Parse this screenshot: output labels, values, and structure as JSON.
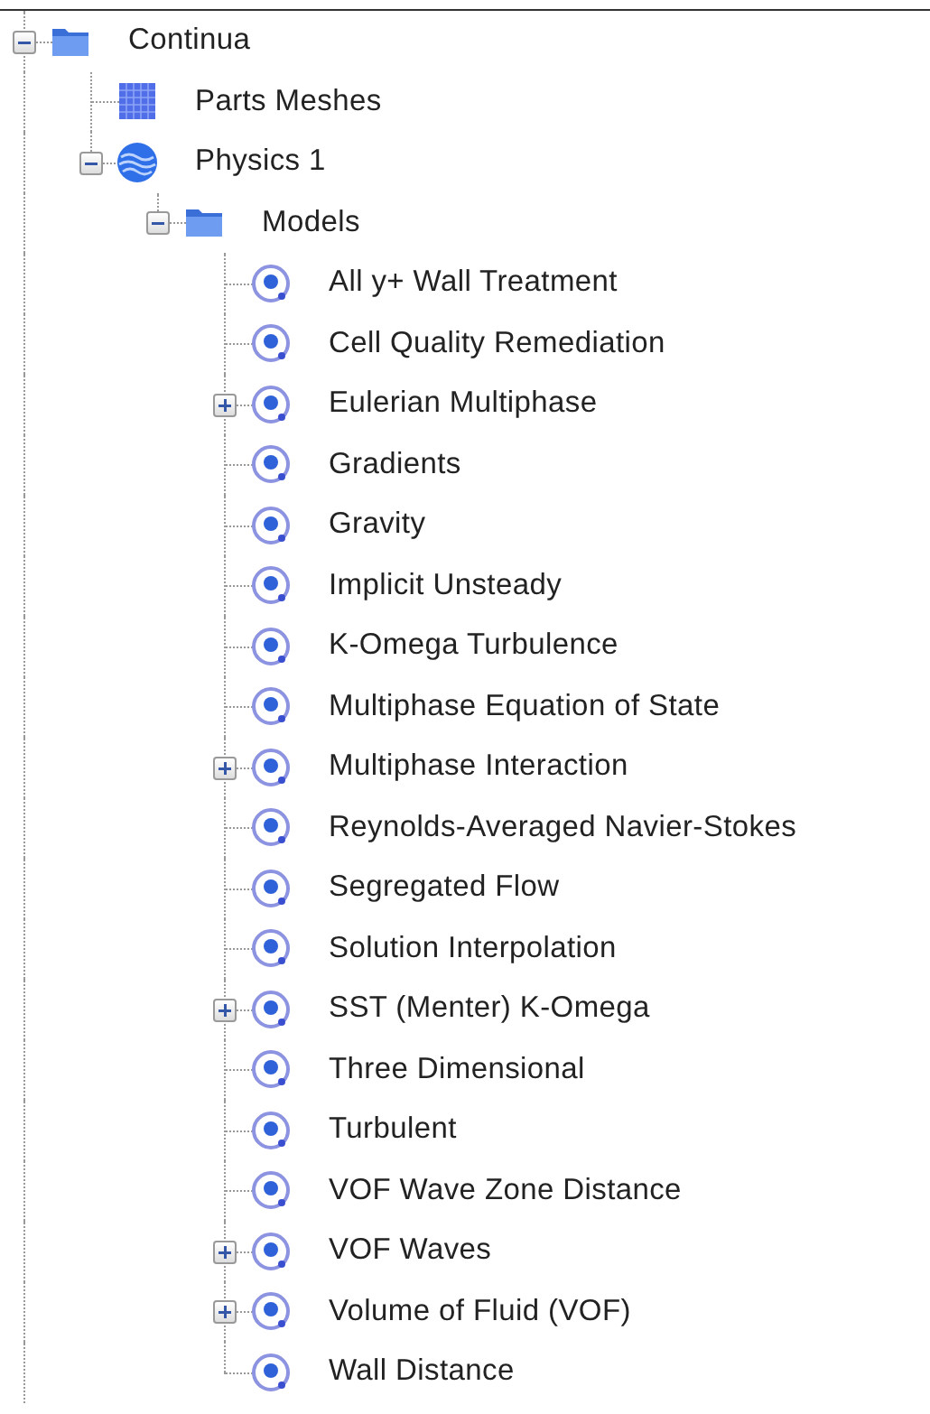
{
  "tree": [
    {
      "label": "Continua",
      "kind": "folder",
      "expanded": true,
      "children": [
        {
          "label": "Parts Meshes",
          "kind": "mesh"
        },
        {
          "label": "Physics 1",
          "kind": "physics",
          "expanded": true,
          "children": [
            {
              "label": "Models",
              "kind": "folder",
              "expanded": true,
              "children": [
                {
                  "label": "All y+ Wall Treatment",
                  "kind": "model"
                },
                {
                  "label": "Cell Quality Remediation",
                  "kind": "model"
                },
                {
                  "label": "Eulerian Multiphase",
                  "kind": "model",
                  "expanded": false
                },
                {
                  "label": "Gradients",
                  "kind": "model"
                },
                {
                  "label": "Gravity",
                  "kind": "model"
                },
                {
                  "label": "Implicit Unsteady",
                  "kind": "model"
                },
                {
                  "label": "K-Omega Turbulence",
                  "kind": "model"
                },
                {
                  "label": "Multiphase Equation of State",
                  "kind": "model"
                },
                {
                  "label": "Multiphase Interaction",
                  "kind": "model",
                  "expanded": false
                },
                {
                  "label": "Reynolds-Averaged Navier-Stokes",
                  "kind": "model"
                },
                {
                  "label": "Segregated Flow",
                  "kind": "model"
                },
                {
                  "label": "Solution Interpolation",
                  "kind": "model"
                },
                {
                  "label": "SST (Menter) K-Omega",
                  "kind": "model",
                  "expanded": false
                },
                {
                  "label": "Three Dimensional",
                  "kind": "model"
                },
                {
                  "label": "Turbulent",
                  "kind": "model"
                },
                {
                  "label": "VOF Wave Zone Distance",
                  "kind": "model"
                },
                {
                  "label": "VOF Waves",
                  "kind": "model",
                  "expanded": false
                },
                {
                  "label": "Volume of Fluid (VOF)",
                  "kind": "model",
                  "expanded": false
                },
                {
                  "label": "Wall Distance",
                  "kind": "model"
                }
              ]
            }
          ]
        }
      ]
    }
  ]
}
